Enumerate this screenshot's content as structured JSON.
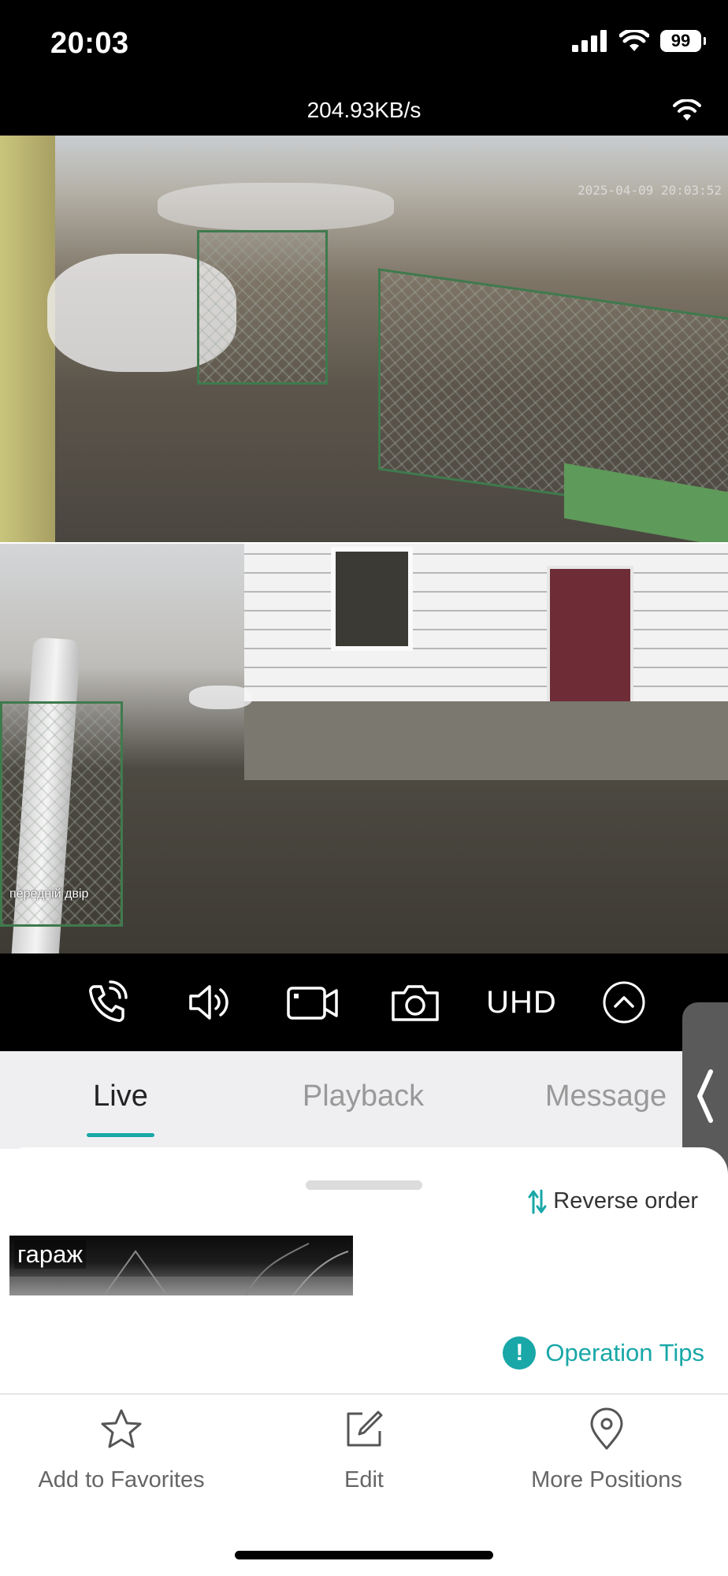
{
  "status_bar": {
    "time": "20:03",
    "battery": "99"
  },
  "stream": {
    "speed": "204.93KB/s"
  },
  "feeds": [
    {
      "name": "camera-1",
      "osd_time": "2025-04-09 20:03:52"
    },
    {
      "name": "camera-2",
      "osd_name": "передній двір"
    }
  ],
  "controls": {
    "quality": "UHD"
  },
  "tabs": [
    {
      "label": "Live",
      "active": true
    },
    {
      "label": "Playback",
      "active": false
    },
    {
      "label": "Message",
      "active": false
    }
  ],
  "sheet": {
    "reverse_label": "Reverse order",
    "devices": [
      {
        "label": "гараж"
      }
    ],
    "tips_label": "Operation Tips",
    "tips_icon": "!"
  },
  "bottom_bar": [
    {
      "label": "Add to Favorites",
      "icon": "star-icon"
    },
    {
      "label": "Edit",
      "icon": "edit-icon"
    },
    {
      "label": "More Positions",
      "icon": "location-pin-icon"
    }
  ],
  "colors": {
    "accent": "#19a7a7",
    "background_dark": "#000000",
    "tab_bg": "#efeff2"
  }
}
